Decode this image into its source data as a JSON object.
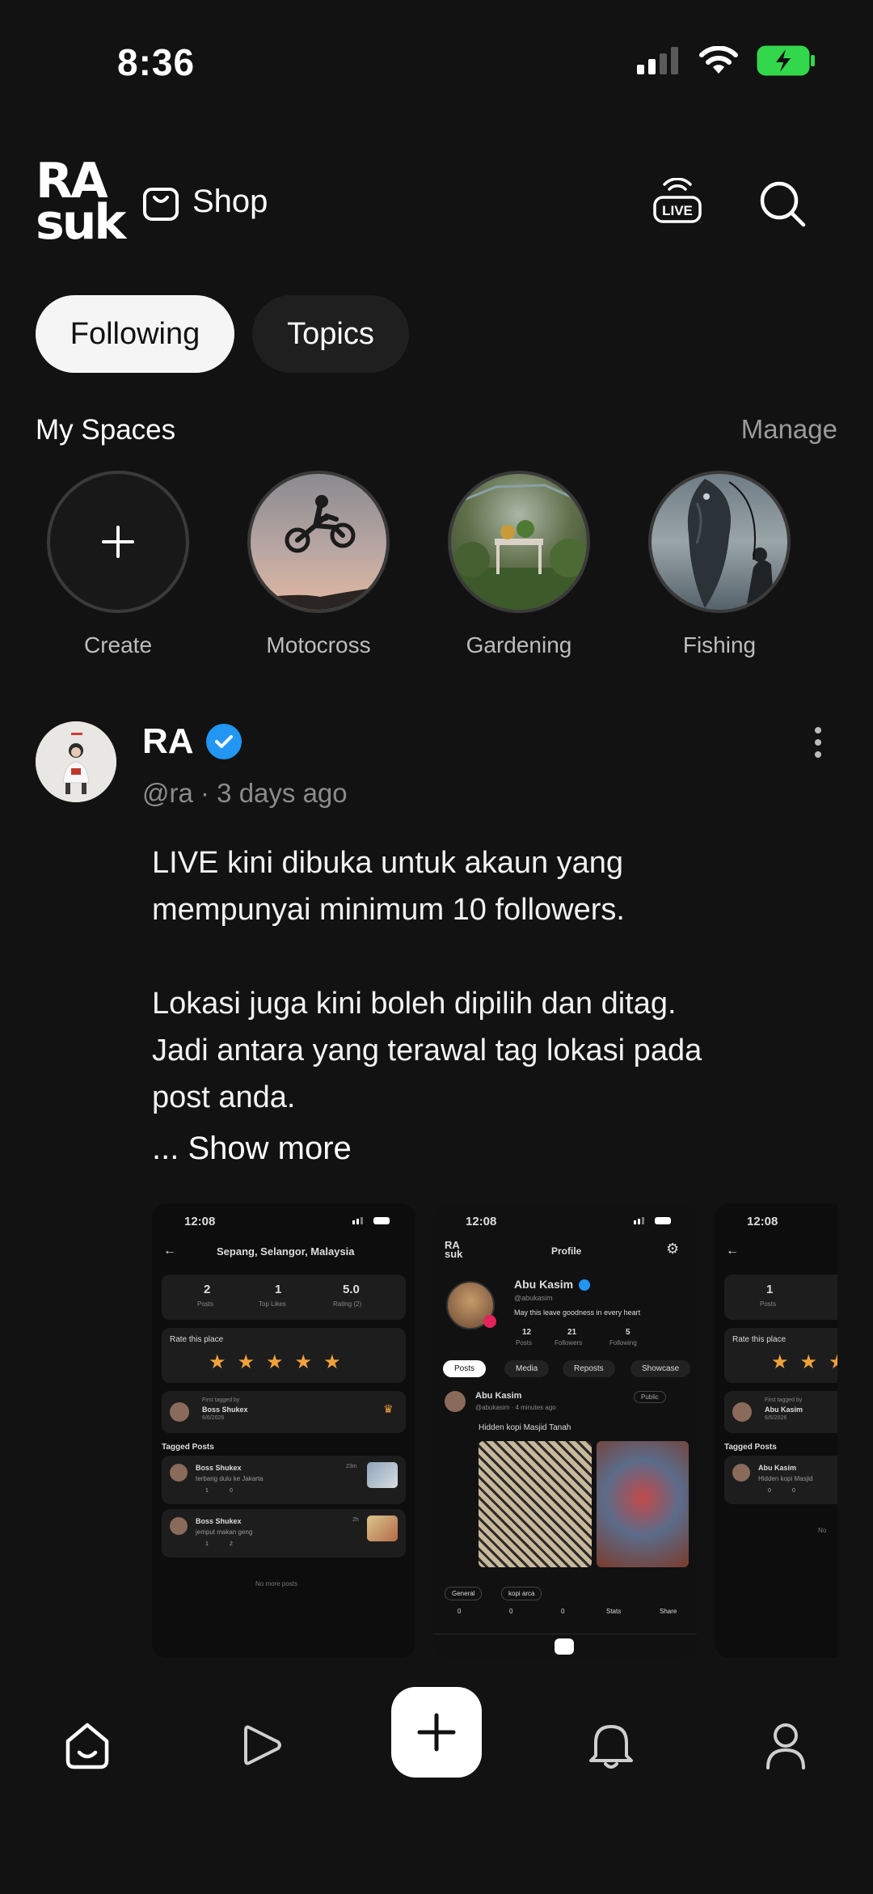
{
  "status_bar": {
    "time": "8:36"
  },
  "header": {
    "logo_top": "RA",
    "logo_bottom": "suk",
    "shop_label": "Shop",
    "live_label": "LIVE"
  },
  "tabs": [
    {
      "label": "Following",
      "active": true
    },
    {
      "label": "Topics",
      "active": false
    }
  ],
  "spaces": {
    "title": "My Spaces",
    "manage_label": "Manage",
    "items": [
      {
        "label": "Create"
      },
      {
        "label": "Motocross"
      },
      {
        "label": "Gardening"
      },
      {
        "label": "Fishing"
      }
    ]
  },
  "post": {
    "author": "RA",
    "meta": "@ra · 3 days ago",
    "body": "LIVE kini dibuka untuk akaun yang\nmempunyai minimum 10 followers.\n\nLokasi juga kini boleh dipilih dan ditag.\nJadi antara yang terawal tag lokasi pada\npost anda.",
    "show_more": "... Show more",
    "media": {
      "shot1": {
        "time": "12:08",
        "location": "Sepang, Selangor, Malaysia",
        "stats": [
          {
            "value": "2",
            "label": "Posts"
          },
          {
            "value": "1",
            "label": "Top Likes"
          },
          {
            "value": "5.0",
            "label": "Rating (2)"
          }
        ],
        "rate_label": "Rate this place",
        "first_tagged_label": "First tagged by",
        "first_tagged_name": "Boss Shukex",
        "first_tagged_date": "6/6/2026",
        "tagged_posts_label": "Tagged Posts",
        "posts": [
          {
            "name": "Boss Shukex",
            "text": "terbang dulu ke Jakarta",
            "time": "23m",
            "likes": "1",
            "comments": "0"
          },
          {
            "name": "Boss Shukex",
            "text": "jemput makan geng",
            "time": "2h",
            "likes": "1",
            "comments": "2"
          }
        ],
        "end_label": "No more posts"
      },
      "shot2": {
        "time": "12:08",
        "title": "Profile",
        "name": "Abu Kasim",
        "handle": "@abukasim",
        "bio": "May this leave goodness in every heart",
        "stats": [
          {
            "value": "12",
            "label": "Posts"
          },
          {
            "value": "21",
            "label": "Followers"
          },
          {
            "value": "5",
            "label": "Following"
          }
        ],
        "tabs": [
          "Posts",
          "Media",
          "Reposts",
          "Showcase"
        ],
        "post_name": "Abu Kasim",
        "post_meta": "@abukasim · 4 minutes ago",
        "visibility": "Public",
        "post_text": "Hidden kopi Masjid Tanah",
        "tags": [
          "General",
          "kopi arca"
        ],
        "actions": [
          "0",
          "0",
          "0",
          "Stats",
          "Share"
        ]
      },
      "shot3": {
        "time": "12:08",
        "stats_value": "1",
        "stats_label": "Posts",
        "rate_label": "Rate this place",
        "first_tagged_label": "First tagged by",
        "first_tagged_name": "Abu Kasim",
        "first_tagged_date": "6/6/2026",
        "tagged_posts_label": "Tagged Posts",
        "post_name": "Abu Kasim",
        "post_text": "Hidden kopi Masjid",
        "likes": "0",
        "comments": "0",
        "end_label": "No"
      }
    }
  }
}
